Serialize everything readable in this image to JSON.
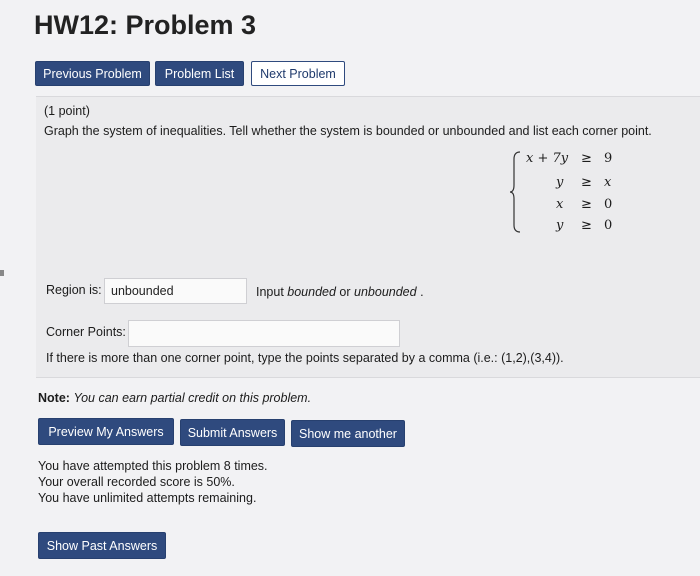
{
  "page": {
    "title": "HW12: Problem 3"
  },
  "nav": {
    "prev": "Previous Problem",
    "list": "Problem List",
    "next": "Next Problem"
  },
  "problem": {
    "points": "(1 point)",
    "statement": "Graph the system of inequalities. Tell whether the system is bounded or unbounded and list each corner point.",
    "system": [
      {
        "lhs": "x + 7y",
        "rel": "≥",
        "rhs": "9"
      },
      {
        "lhs": "y",
        "rel": "≥",
        "rhs": "x"
      },
      {
        "lhs": "x",
        "rel": "≥",
        "rhs": "0"
      },
      {
        "lhs": "y",
        "rel": "≥",
        "rhs": "0"
      }
    ],
    "region_label": "Region is:",
    "region_value": "unbounded",
    "region_hint_prefix": "Input ",
    "region_hint_em": "bounded",
    "region_hint_or": " or ",
    "region_hint_em2": "unbounded",
    "region_hint_suffix": " .",
    "corner_label": "Corner Points:",
    "corner_value": "",
    "corner_hint": "If there is more than one corner point, type the points separated by a comma (i.e.: (1,2),(3,4))."
  },
  "note": {
    "label": "Note:",
    "text": "You can earn partial credit on this problem."
  },
  "actions": {
    "preview": "Preview My Answers",
    "submit": "Submit Answers",
    "show_another": "Show me another"
  },
  "status": {
    "attempts": "You have attempted this problem 8 times.",
    "score": "Your overall recorded score is 50%.",
    "remaining": "You have unlimited attempts remaining."
  },
  "past": {
    "label": "Show Past Answers"
  },
  "colors": {
    "accent": "#2f4a7e",
    "background": "#f2f2f4",
    "panel": "#ebebed"
  }
}
